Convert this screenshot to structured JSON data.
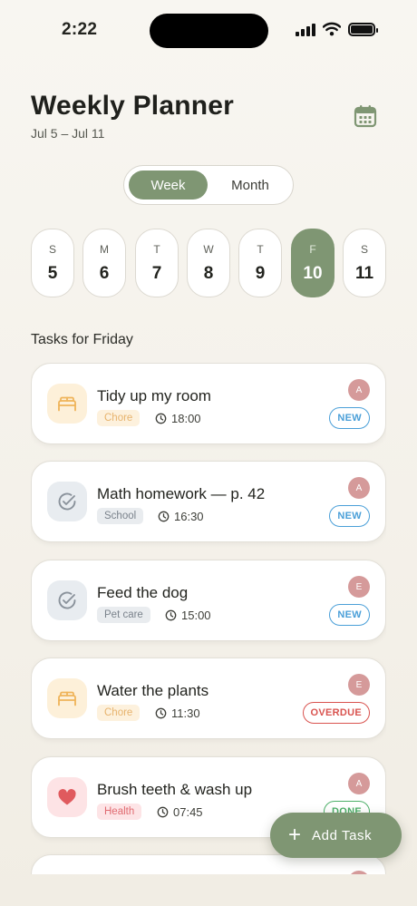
{
  "status_bar": {
    "time": "2:22"
  },
  "header": {
    "title": "Weekly Planner",
    "range": "Jul 5 – Jul 11",
    "calendar_icon": "calendar-icon"
  },
  "toggle": {
    "week": "Week",
    "month": "Month",
    "selected": "Week"
  },
  "days": [
    {
      "dow": "S",
      "num": "5"
    },
    {
      "dow": "M",
      "num": "6"
    },
    {
      "dow": "T",
      "num": "7"
    },
    {
      "dow": "W",
      "num": "8"
    },
    {
      "dow": "T",
      "num": "9"
    },
    {
      "dow": "F",
      "num": "10",
      "active": true
    },
    {
      "dow": "S",
      "num": "11"
    }
  ],
  "section_title": "Tasks for Friday",
  "tasks": [
    {
      "title": "Tidy up my room",
      "tag": "Chore",
      "time": "18:00",
      "avatar": "A",
      "status": "NEW",
      "icon": "bed-icon"
    },
    {
      "title": "Math homework — p. 42",
      "tag": "School",
      "time": "16:30",
      "avatar": "A",
      "status": "NEW",
      "icon": "check-circle-icon"
    },
    {
      "title": "Feed the dog",
      "tag": "Pet care",
      "time": "15:00",
      "avatar": "E",
      "status": "NEW",
      "icon": "check-circle-icon"
    },
    {
      "title": "Water the plants",
      "tag": "Chore",
      "time": "11:30",
      "avatar": "E",
      "status": "OVERDUE",
      "icon": "bed-icon"
    },
    {
      "title": "Brush teeth & wash up",
      "tag": "Health",
      "time": "07:45",
      "avatar": "A",
      "status": "DONE",
      "icon": "heart-icon"
    }
  ],
  "fab": {
    "label": "Add Task"
  },
  "colors": {
    "accent": "#7f9673",
    "new": "#4a9fd8",
    "overdue": "#d9534f",
    "done": "#4caf68",
    "avatar": "#d59a9a"
  }
}
